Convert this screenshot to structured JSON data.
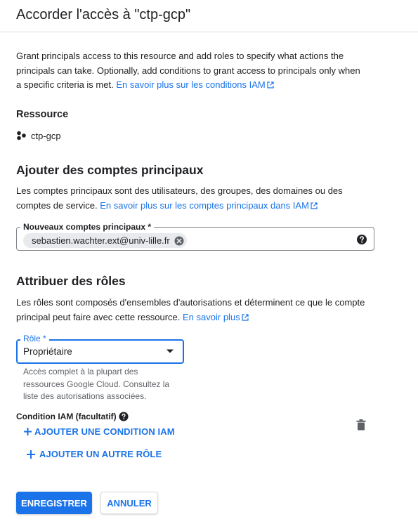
{
  "dialog": {
    "title": "Accorder l'accès à \"ctp-gcp\""
  },
  "intro": {
    "text": "Grant principals access to this resource and add roles to specify what actions the principals can take. Optionally, add conditions to grant access to principals only when a specific criteria is met. ",
    "link": "En savoir plus sur les conditions IAM"
  },
  "resource": {
    "heading": "Ressource",
    "name": "ctp-gcp",
    "icon": "project-nodes-icon"
  },
  "add_principals": {
    "heading": "Ajouter des comptes principaux",
    "description": "Les comptes principaux sont des utilisateurs, des groupes, des domaines ou des comptes de service. ",
    "link": "En savoir plus sur les comptes principaux dans IAM",
    "field_label": "Nouveaux comptes principaux *",
    "chips": [
      "sebastien.wachter.ext@univ-lille.fr"
    ]
  },
  "roles": {
    "heading": "Attribuer des rôles",
    "description": "Les rôles sont composés d'ensembles d'autorisations et déterminent ce que le compte principal peut faire avec cette ressource. ",
    "link": "En savoir plus",
    "role_label": "Rôle *",
    "role_value": "Propriétaire",
    "role_help": "Accès complet à la plupart des ressources Google Cloud. Consultez la liste des autorisations associées.",
    "condition_label": "Condition IAM (facultatif)",
    "add_condition": "AJOUTER UNE CONDITION IAM",
    "add_role": "AJOUTER UN AUTRE RÔLE"
  },
  "actions": {
    "save": "ENREGISTRER",
    "cancel": "ANNULER"
  },
  "colors": {
    "accent": "#1a73e8",
    "text": "#202124",
    "muted": "#5f6368",
    "chip": "#e8eaed"
  }
}
